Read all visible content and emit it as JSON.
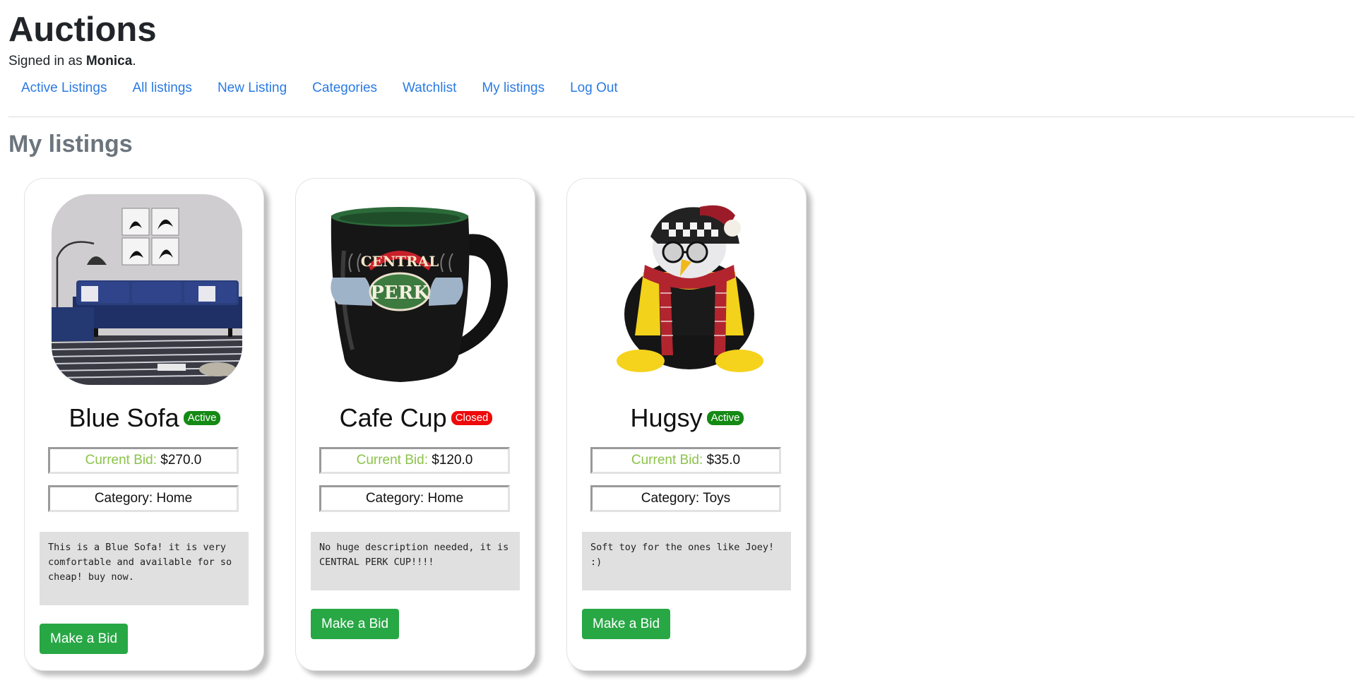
{
  "header": {
    "title": "Auctions",
    "signed_prefix": "Signed in as ",
    "user": "Monica",
    "signed_suffix": "."
  },
  "nav": {
    "items": [
      {
        "label": "Active Listings"
      },
      {
        "label": "All listings"
      },
      {
        "label": "New Listing"
      },
      {
        "label": "Categories"
      },
      {
        "label": "Watchlist"
      },
      {
        "label": "My listings"
      },
      {
        "label": "Log Out"
      }
    ]
  },
  "main": {
    "title": "My listings",
    "listings": [
      {
        "name": "Blue Sofa",
        "status": "Active",
        "bid_label": "Current Bid:",
        "bid_value": "$270.0",
        "category": "Category: Home",
        "description": "This is a Blue Sofa! it is very comfortable and available for so cheap! buy now.",
        "button": "Make a Bid"
      },
      {
        "name": "Cafe Cup",
        "status": "Closed",
        "bid_label": "Current Bid:",
        "bid_value": "$120.0",
        "category": "Category: Home",
        "description": "No huge description needed, it is CENTRAL PERK CUP!!!!",
        "button": "Make a Bid"
      },
      {
        "name": "Hugsy",
        "status": "Active",
        "bid_label": "Current Bid:",
        "bid_value": "$35.0",
        "category": "Category: Toys",
        "description": "Soft toy for the ones like Joey! :)",
        "button": "Make a Bid"
      }
    ],
    "image_labels": {
      "cup_logo_top": "CENTRAL",
      "cup_logo_bottom": "PERK"
    }
  },
  "colors": {
    "link": "#2a7ae2",
    "active_badge": "#148a14",
    "closed_badge": "#ee0a0a",
    "button": "#28a745",
    "bid_label": "#8bc34a"
  }
}
